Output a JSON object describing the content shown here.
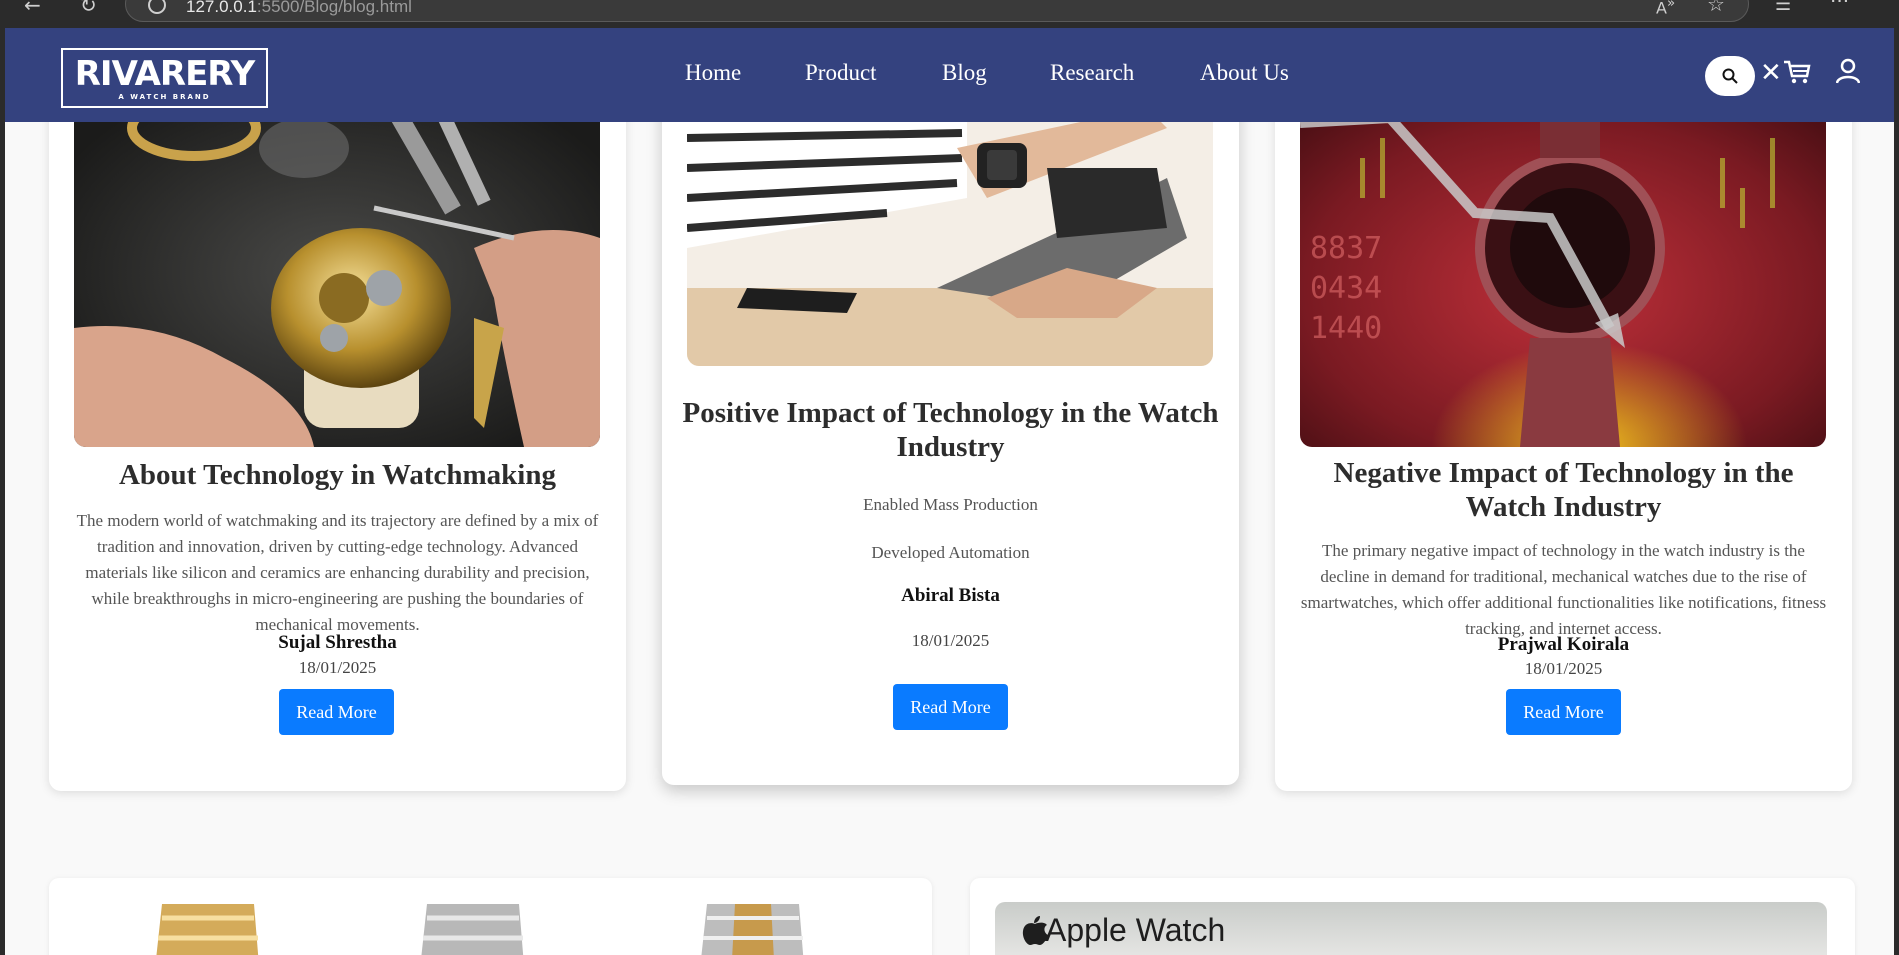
{
  "browser": {
    "url_host": "127.0.0.1",
    "url_rest": ":5500/Blog/blog.html"
  },
  "header": {
    "logo_text": "RIVARERY",
    "logo_sub": "A WATCH BRAND",
    "nav": [
      "Home",
      "Product",
      "Blog",
      "Research",
      "About Us"
    ]
  },
  "cards": [
    {
      "title": "About Technology in Watchmaking",
      "text": "The modern world of watchmaking and its trajectory are defined by a mix of tradition and innovation, driven by cutting-edge technology. Advanced materials like silicon and ceramics are enhancing durability and precision, while breakthroughs in micro-engineering are pushing the boundaries of mechanical movements.",
      "author": "Sujal Shrestha",
      "date": "18/01/2025",
      "button": "Read More"
    },
    {
      "title": "Positive Impact of Technology in the Watch Industry",
      "point1": "Enabled Mass Production",
      "point2": "Developed Automation",
      "author": "Abiral Bista",
      "date": "18/01/2025",
      "button": "Read More"
    },
    {
      "title": "Negative Impact of Technology in the Watch Industry",
      "text": "The primary negative impact of technology in the watch industry is the decline in demand for traditional, mechanical watches due to the rise of smartwatches, which offer additional functionalities like notifications, fitness tracking, and internet access.",
      "author": "Prajwal Koirala",
      "date": "18/01/2025",
      "button": "Read More"
    }
  ],
  "banner": {
    "apple_text": "Apple Watch"
  },
  "colors": {
    "header": "#34427f",
    "button": "#0a7bff"
  }
}
